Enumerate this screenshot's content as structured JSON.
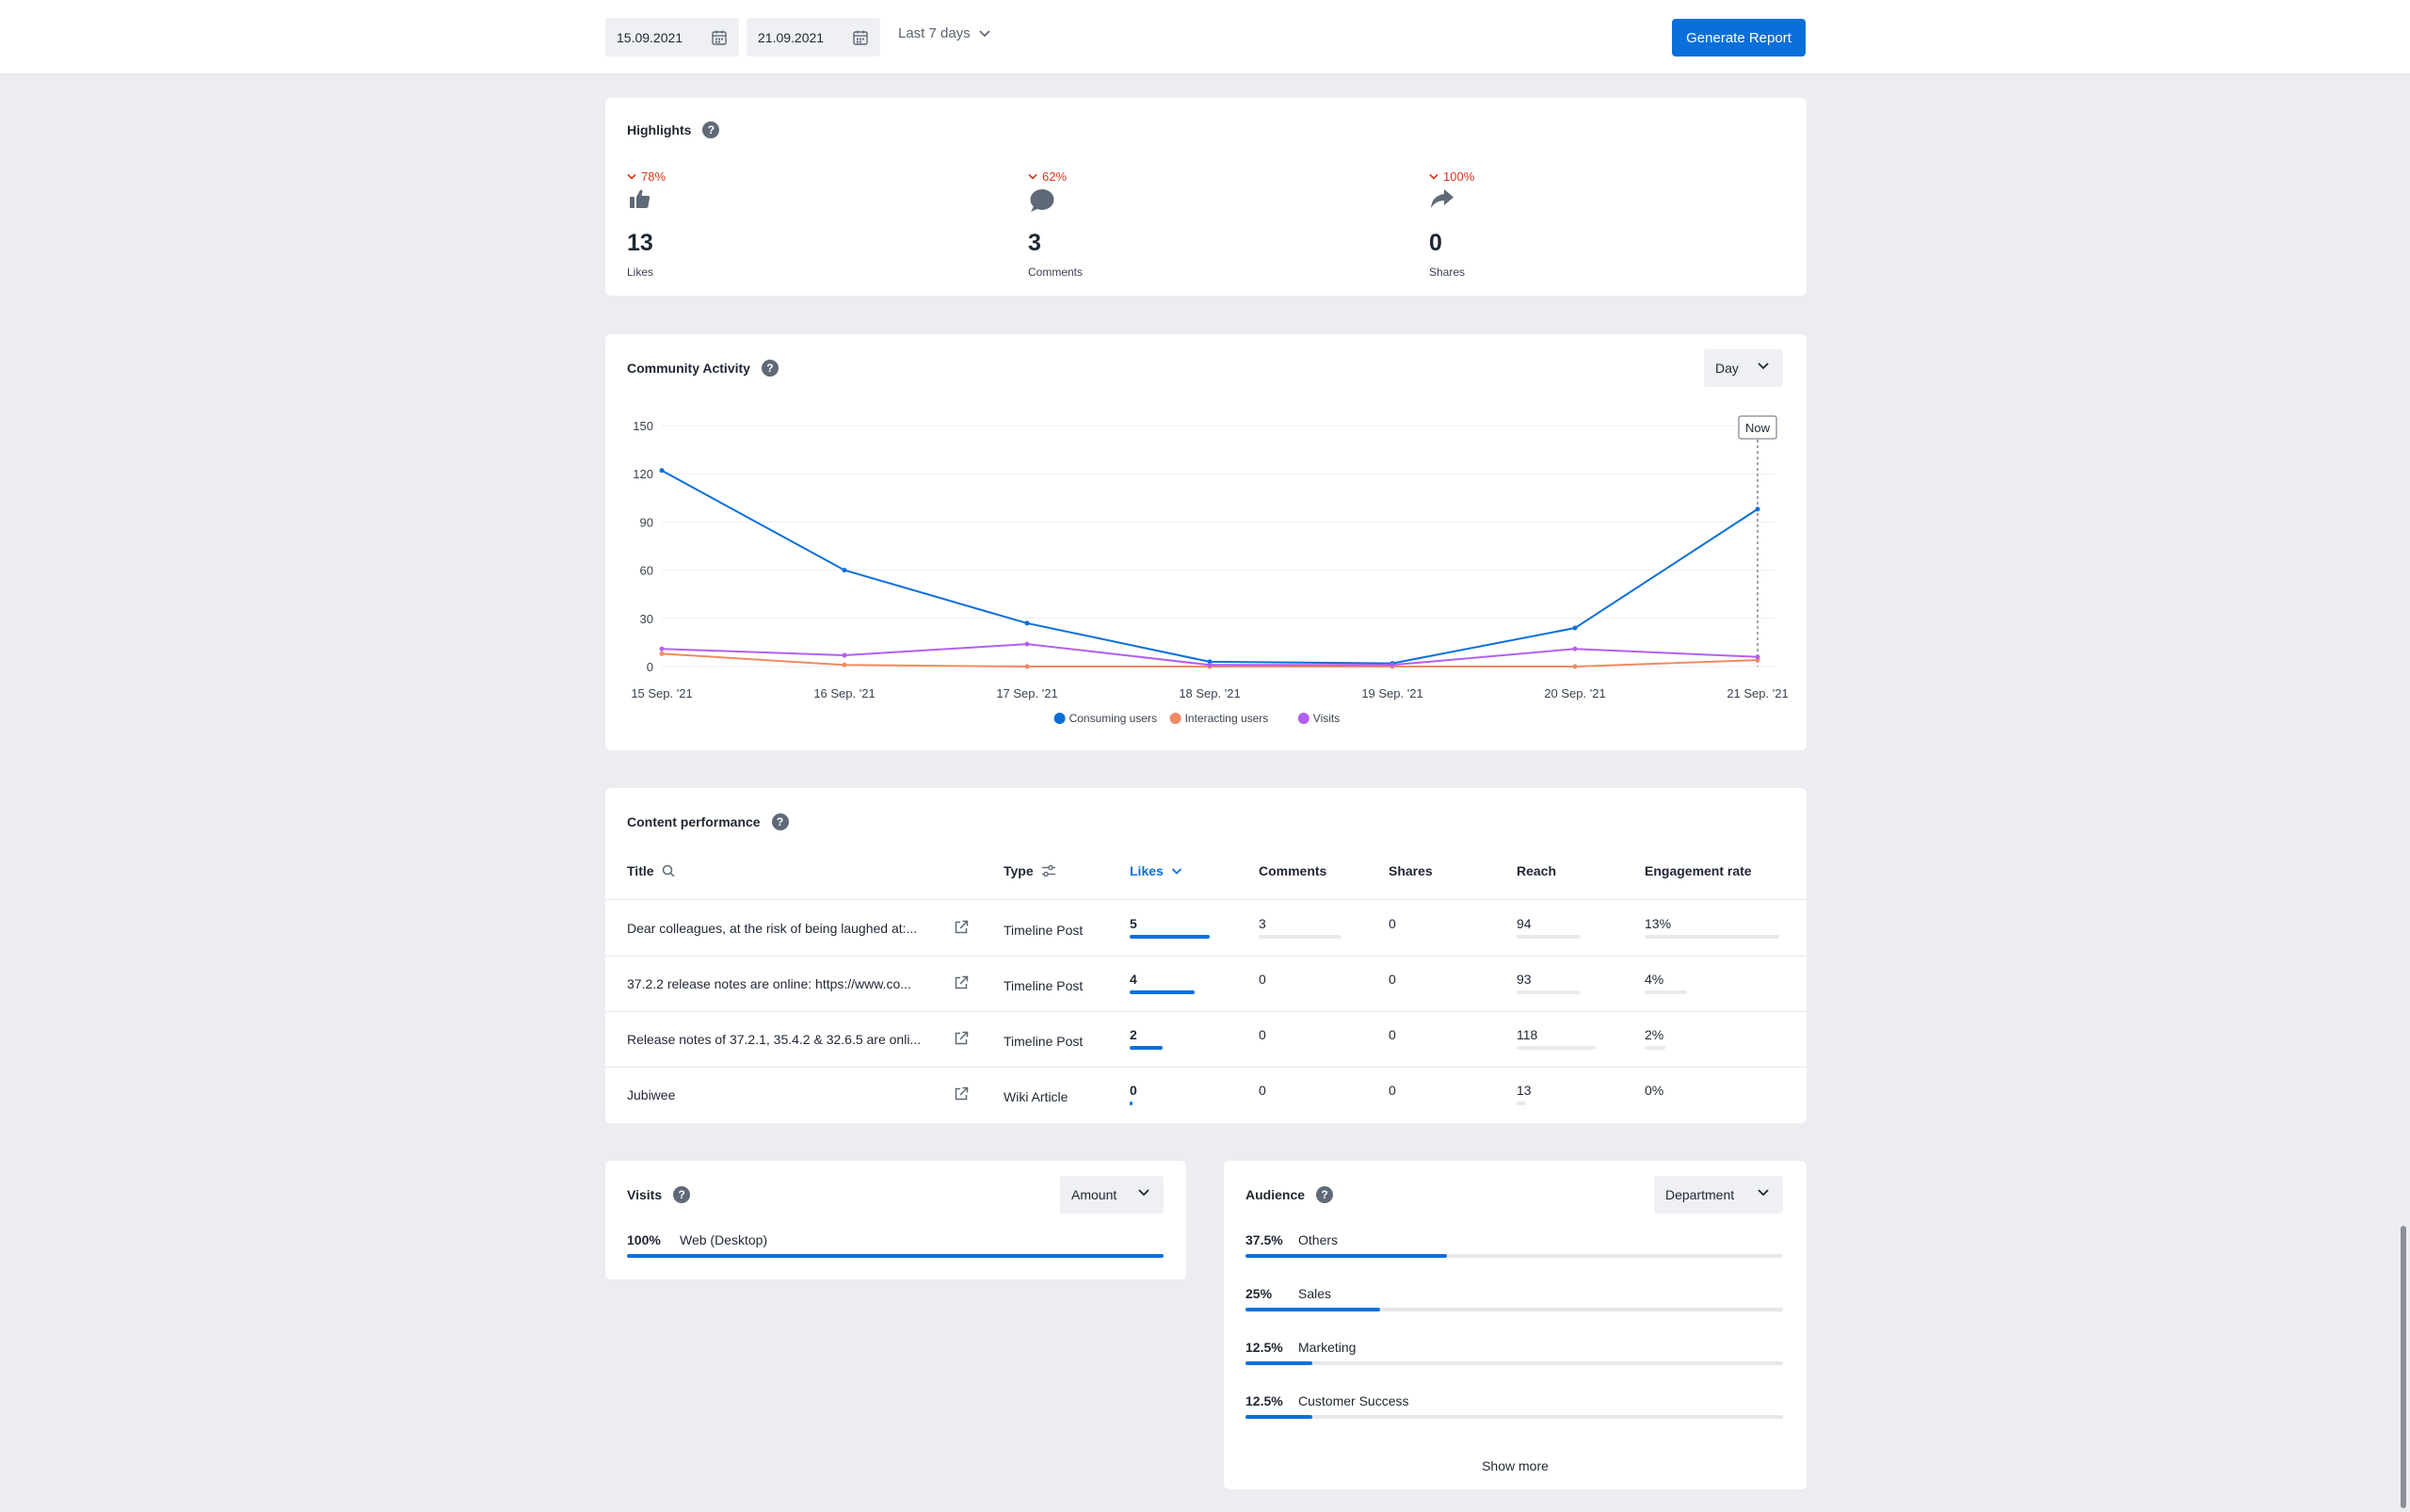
{
  "toolbar": {
    "start_date": "15.09.2021",
    "end_date": "21.09.2021",
    "range": "Last 7 days",
    "generate_label": "Generate Report"
  },
  "highlights": {
    "title": "Highlights",
    "items": [
      {
        "delta": "78%",
        "value": "13",
        "label": "Likes",
        "icon": "thumbs-up-icon"
      },
      {
        "delta": "62%",
        "value": "3",
        "label": "Comments",
        "icon": "comment-icon"
      },
      {
        "delta": "100%",
        "value": "0",
        "label": "Shares",
        "icon": "share-icon"
      }
    ]
  },
  "activity": {
    "title": "Community Activity",
    "granularity": "Day",
    "now_label": "Now"
  },
  "chart_data": {
    "type": "line",
    "x": [
      "15 Sep. '21",
      "16 Sep. '21",
      "17 Sep. '21",
      "18 Sep. '21",
      "19 Sep. '21",
      "20 Sep. '21",
      "21 Sep. '21"
    ],
    "ylim": [
      0,
      150
    ],
    "yticks": [
      0,
      30,
      60,
      90,
      120,
      150
    ],
    "grid": true,
    "legend_position": "bottom-center",
    "series": [
      {
        "name": "Consuming users",
        "color": "#0a6fdb",
        "values": [
          122,
          60,
          27,
          3,
          2,
          24,
          98
        ]
      },
      {
        "name": "Interacting users",
        "color": "#f08a62",
        "values": [
          8,
          1,
          0,
          0,
          0,
          0,
          4
        ]
      },
      {
        "name": "Visits",
        "color": "#b35ff0",
        "values": [
          11,
          7,
          14,
          1,
          1,
          11,
          6
        ]
      }
    ]
  },
  "content": {
    "title": "Content performance",
    "headers": {
      "title": "Title",
      "type": "Type",
      "likes": "Likes",
      "comments": "Comments",
      "shares": "Shares",
      "reach": "Reach",
      "engagement": "Engagement rate"
    },
    "rows": [
      {
        "title": "Dear colleagues, at the risk of being laughed at:...",
        "type": "Timeline Post",
        "likes": "5",
        "comments": "3",
        "shares": "0",
        "reach": "94",
        "engagement": "13%"
      },
      {
        "title": "37.2.2 release notes are online: https://www.co...",
        "type": "Timeline Post",
        "likes": "4",
        "comments": "0",
        "shares": "0",
        "reach": "93",
        "engagement": "4%"
      },
      {
        "title": "Release notes of 37.2.1, 35.4.2 & 32.6.5 are onli...",
        "type": "Timeline Post",
        "likes": "2",
        "comments": "0",
        "shares": "0",
        "reach": "118",
        "engagement": "2%"
      },
      {
        "title": "Jubiwee",
        "type": "Wiki Article",
        "likes": "0",
        "comments": "0",
        "shares": "0",
        "reach": "13",
        "engagement": "0%"
      }
    ]
  },
  "visits": {
    "title": "Visits",
    "select": "Amount",
    "items": [
      {
        "pct": "100%",
        "label": "Web (Desktop)",
        "fraction": 1.0
      }
    ]
  },
  "audience": {
    "title": "Audience",
    "select": "Department",
    "items": [
      {
        "pct": "37.5%",
        "label": "Others",
        "fraction": 0.375
      },
      {
        "pct": "25%",
        "label": "Sales",
        "fraction": 0.25
      },
      {
        "pct": "12.5%",
        "label": "Marketing",
        "fraction": 0.125
      },
      {
        "pct": "12.5%",
        "label": "Customer Success",
        "fraction": 0.125
      }
    ],
    "show_more": "Show more"
  }
}
